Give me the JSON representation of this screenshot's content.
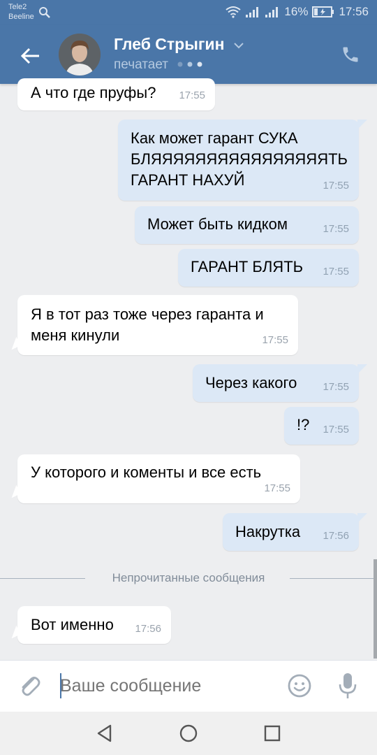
{
  "status_bar": {
    "carrier_1": "Tele2",
    "carrier_2": "Beeline",
    "battery": "16%",
    "time": "17:56"
  },
  "header": {
    "contact_name": "Глеб Стрыгин",
    "status": "печатает"
  },
  "messages": [
    {
      "dir": "in",
      "text": "А что где пруфы?",
      "time": "17:55"
    },
    {
      "dir": "out",
      "text": "Как может гарант СУКА\nБЛЯЯЯЯЯЯЯЯЯЯЯЯЯЯЯЯТЬ\nГАРАНТ НАХУЙ",
      "time": "17:55"
    },
    {
      "dir": "out",
      "text": "Может быть кидком",
      "time": "17:55"
    },
    {
      "dir": "out",
      "text": "ГАРАНТ БЛЯТЬ",
      "time": "17:55"
    },
    {
      "dir": "in",
      "text": "Я в тот раз тоже через гаранта и\nменя кинули",
      "time": "17:55"
    },
    {
      "dir": "out",
      "text": "Через какого",
      "time": "17:55"
    },
    {
      "dir": "out",
      "text": "!?",
      "time": "17:55"
    },
    {
      "dir": "in",
      "text": "У которого и коменты и все есть",
      "time": "17:55"
    },
    {
      "dir": "out",
      "text": "Накрутка",
      "time": "17:56"
    },
    {
      "dir": "in",
      "text": "Вот именно",
      "time": "17:56"
    }
  ],
  "unread_divider": "Непрочитанные сообщения",
  "composer": {
    "placeholder": "Ваше сообщение"
  },
  "colors": {
    "accent": "#4a76a8",
    "outgoing_bubble": "#dce8f6",
    "incoming_bubble": "#ffffff",
    "chat_background": "#edeef0"
  }
}
